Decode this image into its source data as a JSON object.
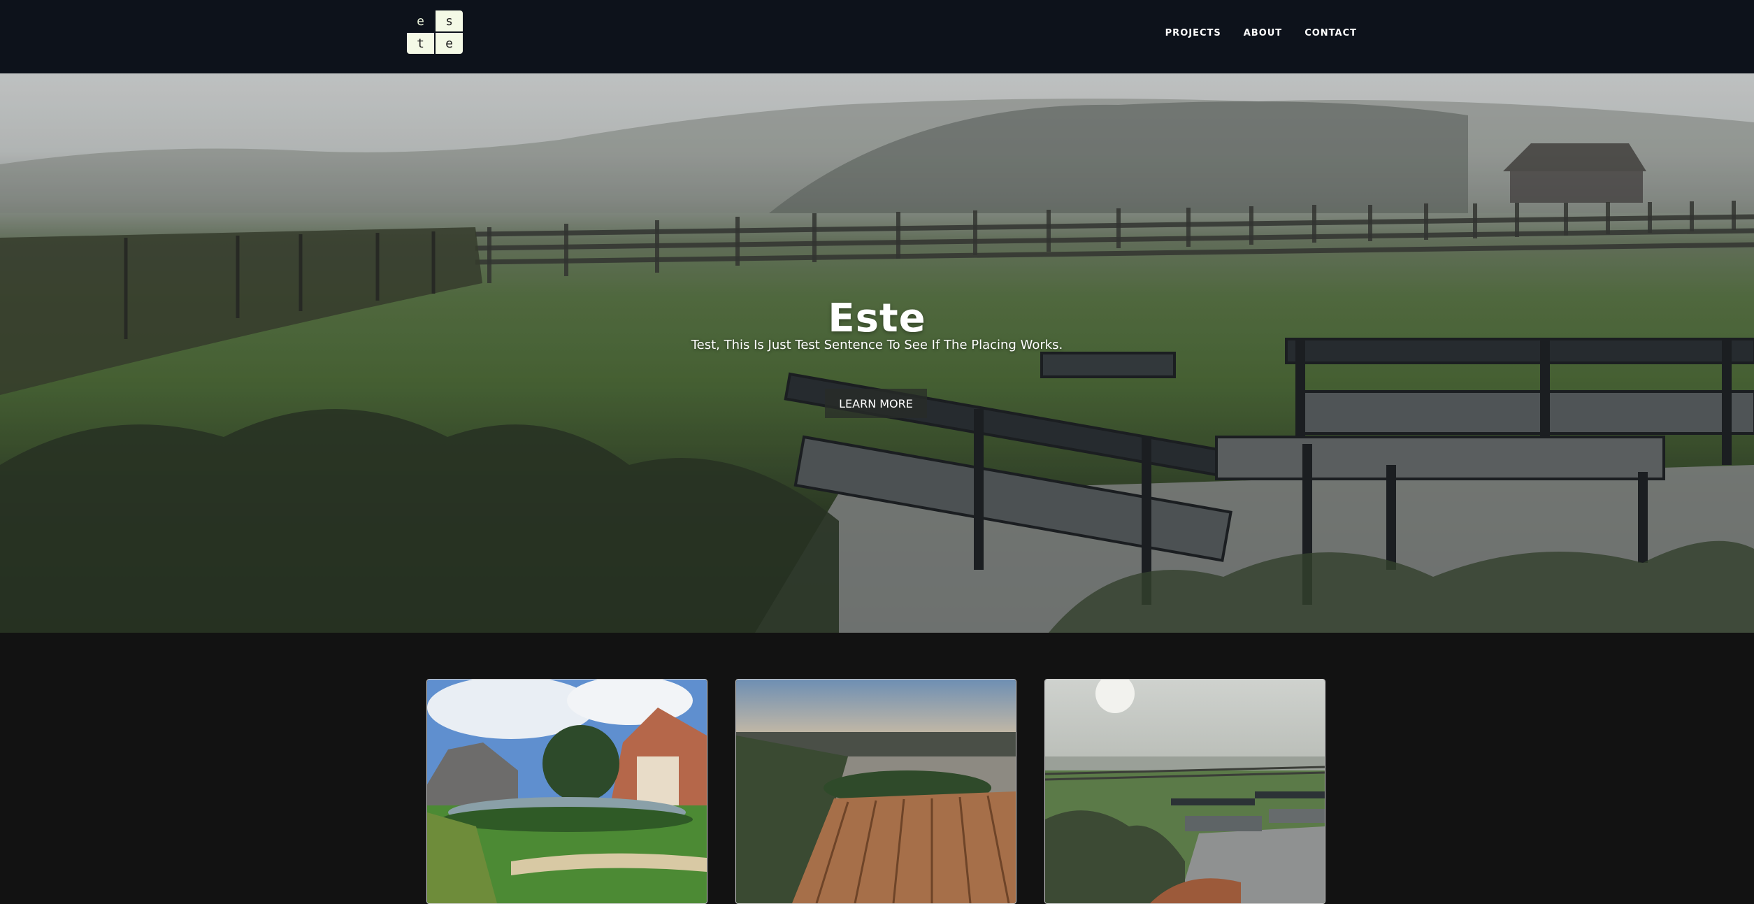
{
  "header": {
    "logo": {
      "letters": [
        "e",
        "s",
        "t",
        "e"
      ]
    },
    "nav": [
      {
        "label": "PROJECTS"
      },
      {
        "label": "ABOUT"
      },
      {
        "label": "CONTACT"
      }
    ]
  },
  "hero": {
    "title": "Este",
    "subtitle": "Test, This Is Just Test Sentence To See If The Placing Works.",
    "button": "LEARN MORE"
  },
  "projects": [
    {
      "icon": "garden-pond-photo"
    },
    {
      "icon": "wooden-deck-photo"
    },
    {
      "icon": "misty-garden-lounge-photo"
    }
  ],
  "colors": {
    "header_bg": "#0d121b",
    "page_bg": "#121212",
    "logo_tile": "#f4f9e6"
  }
}
